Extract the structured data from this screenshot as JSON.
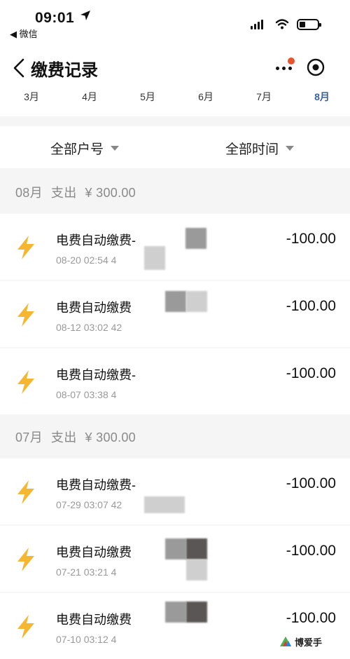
{
  "status_bar": {
    "time": "09:01",
    "back_app": "◀ 微信"
  },
  "nav": {
    "title": "缴费记录",
    "notification_dot_color": "#e8542f"
  },
  "months": [
    {
      "label": "3月",
      "active": false
    },
    {
      "label": "4月",
      "active": false
    },
    {
      "label": "5月",
      "active": false
    },
    {
      "label": "6月",
      "active": false
    },
    {
      "label": "7月",
      "active": false
    },
    {
      "label": "8月",
      "active": true
    }
  ],
  "filters": {
    "account": "全部户号",
    "time": "全部时间"
  },
  "groups": [
    {
      "month": "08月",
      "type": "支出",
      "total": "¥ 300.00",
      "records": [
        {
          "name": "电费自动缴费-",
          "time": "08-20 02:54 4",
          "amount": "-100.00",
          "icon": "lightning-icon"
        },
        {
          "name": "电费自动缴费",
          "time": "08-12 03:02 42",
          "amount": "-100.00",
          "icon": "lightning-icon"
        },
        {
          "name": "电费自动缴费-",
          "time": "08-07 03:38 4",
          "amount": "-100.00",
          "icon": "lightning-icon"
        }
      ]
    },
    {
      "month": "07月",
      "type": "支出",
      "total": "¥ 300.00",
      "records": [
        {
          "name": "电费自动缴费-",
          "time": "07-29 03:07 42",
          "amount": "-100.00",
          "icon": "lightning-icon"
        },
        {
          "name": "电费自动缴费",
          "time": "07-21 03:21 4",
          "amount": "-100.00",
          "icon": "lightning-icon"
        },
        {
          "name": "电费自动缴费",
          "time": "07-10 03:12 4",
          "amount": "-100.00",
          "icon": "lightning-icon"
        }
      ]
    }
  ],
  "colors": {
    "accent": "#3a60a8",
    "bolt": "#f5b731",
    "background": "#f5f5f5"
  },
  "watermark": "博爱手"
}
